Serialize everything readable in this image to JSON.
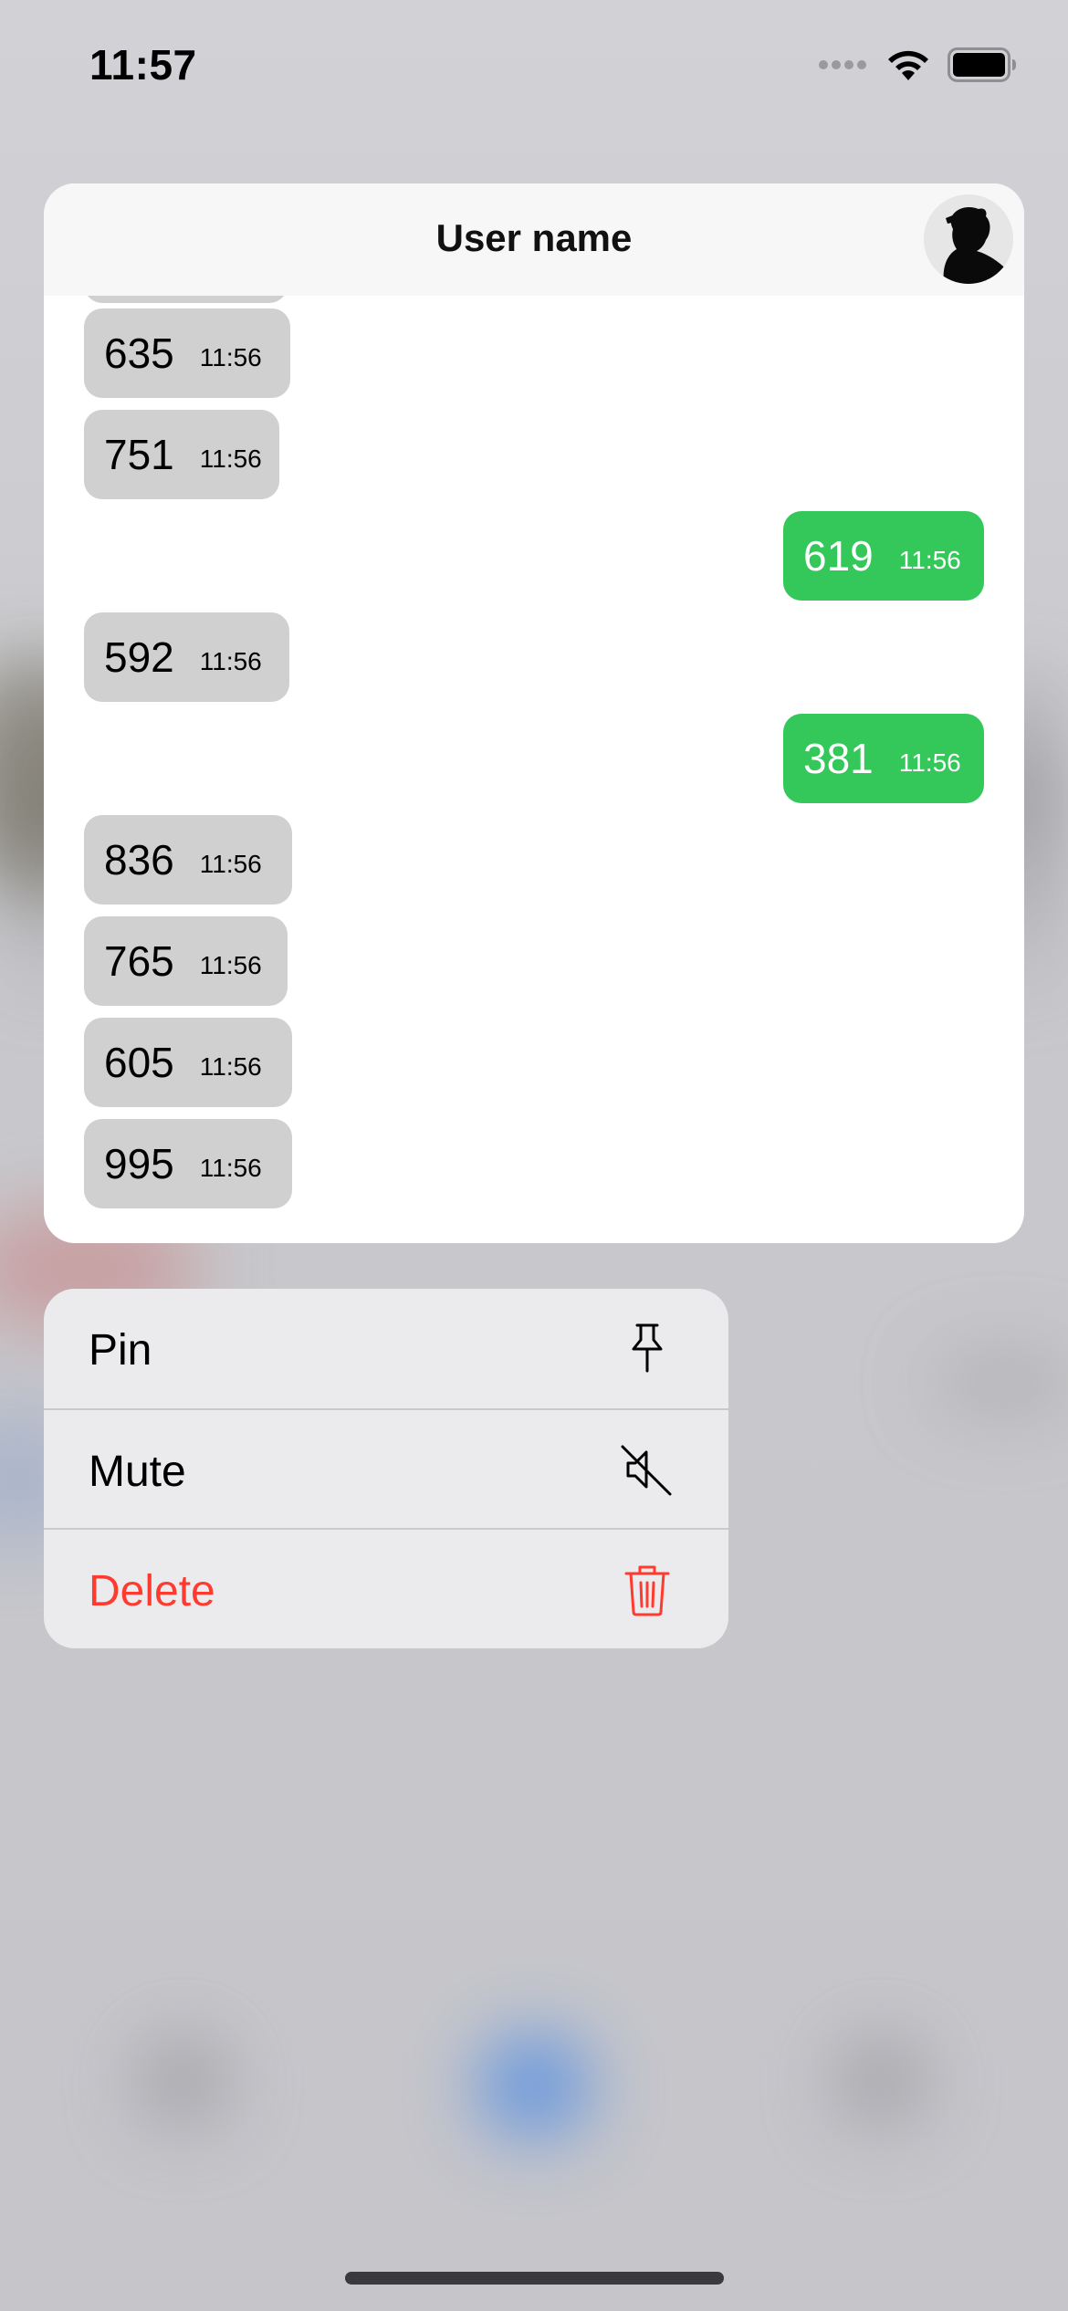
{
  "status_bar": {
    "time": "11:57"
  },
  "preview": {
    "title": "User name",
    "avatar_icon": "person-silhouette-icon",
    "messages": [
      {
        "text": "635",
        "time": "11:56",
        "direction": "incoming"
      },
      {
        "text": "751",
        "time": "11:56",
        "direction": "incoming"
      },
      {
        "text": "619",
        "time": "11:56",
        "direction": "outgoing"
      },
      {
        "text": "592",
        "time": "11:56",
        "direction": "incoming"
      },
      {
        "text": "381",
        "time": "11:56",
        "direction": "outgoing"
      },
      {
        "text": "836",
        "time": "11:56",
        "direction": "incoming"
      },
      {
        "text": "765",
        "time": "11:56",
        "direction": "incoming"
      },
      {
        "text": "605",
        "time": "11:56",
        "direction": "incoming"
      },
      {
        "text": "995",
        "time": "11:56",
        "direction": "incoming"
      }
    ]
  },
  "menu": {
    "items": [
      {
        "label": "Pin",
        "icon": "pin-icon"
      },
      {
        "label": "Mute",
        "icon": "speaker-slash-icon"
      },
      {
        "label": "Delete",
        "icon": "trash-icon",
        "destructive": true
      }
    ]
  },
  "colors": {
    "incoming_bubble": "#d0d0d0",
    "outgoing_bubble": "#34c759",
    "destructive": "#ff3b30",
    "menu_background": "#ebebed"
  }
}
